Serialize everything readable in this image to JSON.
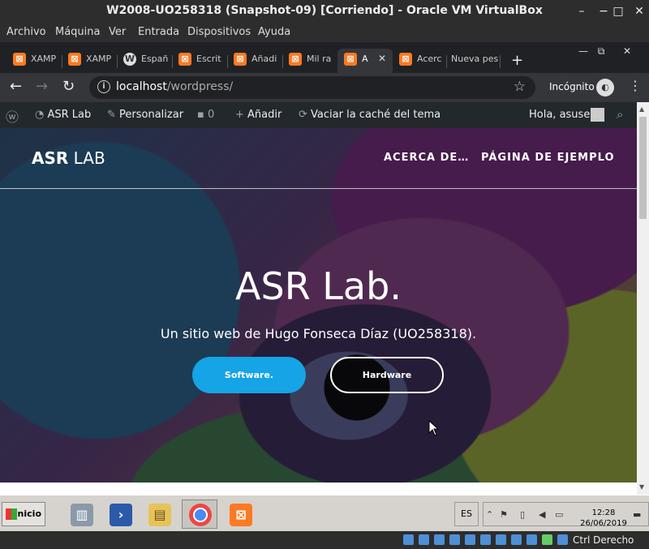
{
  "vbox": {
    "title": "W2008-UO258318 (Snapshot-09) [Corriendo] - Oracle VM VirtualBox",
    "menu": [
      "Archivo",
      "Máquina",
      "Ver",
      "Entrada",
      "Dispositivos",
      "Ayuda"
    ],
    "host_key": "Ctrl Derecho"
  },
  "browser": {
    "tabs": [
      {
        "label": "XAMP",
        "icon": "xampp-icon"
      },
      {
        "label": "XAMP",
        "icon": "xampp-icon"
      },
      {
        "label": "Españ",
        "icon": "wordpress-icon"
      },
      {
        "label": "Escrit",
        "icon": "xampp-icon"
      },
      {
        "label": "Añadi",
        "icon": "xampp-icon"
      },
      {
        "label": "Mil ra",
        "icon": "xampp-icon"
      },
      {
        "label": "A",
        "icon": "xampp-icon",
        "active": true
      },
      {
        "label": "Acerc",
        "icon": "xampp-icon"
      },
      {
        "label": "Nueva pes",
        "icon": ""
      }
    ],
    "url_host": "localhost",
    "url_path": "/wordpress/",
    "incognito_label": "Incógnito"
  },
  "adminbar": {
    "site": "ASR Lab",
    "customize": "Personalizar",
    "comments": "0",
    "add": "Añadir",
    "clear_cache": "Vaciar la caché del tema",
    "greeting": "Hola, asuser"
  },
  "site": {
    "brand_bold": "ASR",
    "brand_rest": " LAB",
    "nav": [
      "ACERCA DE…",
      "PÁGINA DE EJEMPLO"
    ],
    "hero_title": "ASR Lab.",
    "hero_subtitle": "Un sitio web de Hugo Fonseca Díaz (UO258318).",
    "btn_software": "Software.",
    "btn_hardware": "Hardware"
  },
  "taskbar": {
    "start": "Inicio",
    "lang": "ES",
    "time": "12:28",
    "date": "26/06/2019"
  },
  "colors": {
    "accent_button": "#15a4e5",
    "xampp": "#fb7a24",
    "adminbar": "#23282d"
  }
}
